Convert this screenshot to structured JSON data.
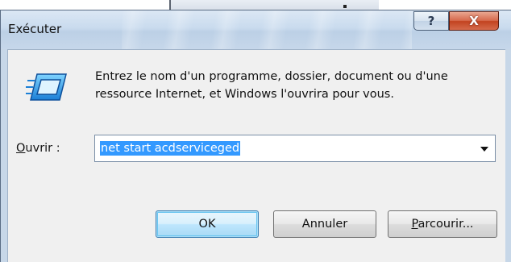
{
  "window": {
    "title": "Exécuter",
    "help_glyph": "?",
    "close_glyph": "X"
  },
  "dialog": {
    "description": "Entrez le nom d'un programme, dossier, document ou d'une ressource Internet, et Windows l'ouvrira pour vous.",
    "open_label_underlined": "O",
    "open_label_rest": "uvrir :",
    "input_value": "net start acdserviceged"
  },
  "buttons": {
    "ok": "OK",
    "cancel": "Annuler",
    "browse_underlined": "P",
    "browse_rest": "arcourir..."
  },
  "icons": {
    "run": "run-program-icon",
    "dropdown": "chevron-down-icon"
  },
  "colors": {
    "selection": "#3399ff",
    "close_button": "#c2421f",
    "dialog_background": "#f0f0f0"
  }
}
